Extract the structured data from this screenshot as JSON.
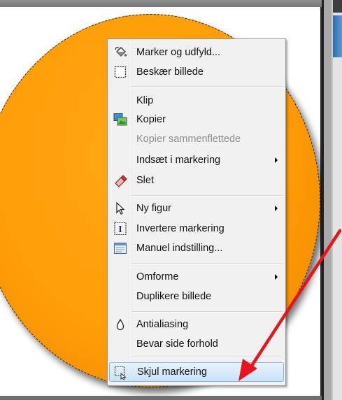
{
  "menu": {
    "items": [
      {
        "label": "Marker og udfyld...",
        "icon": "paint-bucket-icon",
        "submenu": false,
        "enabled": true
      },
      {
        "label": "Beskær billede",
        "icon": "crop-icon",
        "submenu": false,
        "enabled": true
      },
      {
        "label": "Klip",
        "icon": "",
        "submenu": false,
        "enabled": true
      },
      {
        "label": "Kopier",
        "icon": "copy-image-icon",
        "submenu": false,
        "enabled": true
      },
      {
        "label": "Kopier sammenflettede",
        "icon": "",
        "submenu": false,
        "enabled": false
      },
      {
        "label": "Indsæt i markering",
        "icon": "",
        "submenu": true,
        "enabled": true
      },
      {
        "label": "Slet",
        "icon": "eraser-icon",
        "submenu": false,
        "enabled": true
      },
      {
        "label": "Ny figur",
        "icon": "cursor-arrow-icon",
        "submenu": true,
        "enabled": true
      },
      {
        "label": "Invertere markering",
        "icon": "invert-selection-icon",
        "submenu": false,
        "enabled": true
      },
      {
        "label": "Manuel indstilling...",
        "icon": "manual-settings-icon",
        "submenu": false,
        "enabled": true
      },
      {
        "label": "Omforme",
        "icon": "",
        "submenu": true,
        "enabled": true
      },
      {
        "label": "Duplikere billede",
        "icon": "",
        "submenu": false,
        "enabled": true
      },
      {
        "label": "Antialiasing",
        "icon": "droplet-icon",
        "submenu": false,
        "enabled": true
      },
      {
        "label": "Bevar side forhold",
        "icon": "",
        "submenu": false,
        "enabled": true
      },
      {
        "label": "Skjul markering",
        "icon": "hide-selection-icon",
        "submenu": false,
        "enabled": true,
        "highlighted": true
      }
    ]
  },
  "colors": {
    "shape_fill": "#ff9d08",
    "menu_highlight": "#c9e1f8",
    "annotation_arrow": "#e8131b"
  }
}
